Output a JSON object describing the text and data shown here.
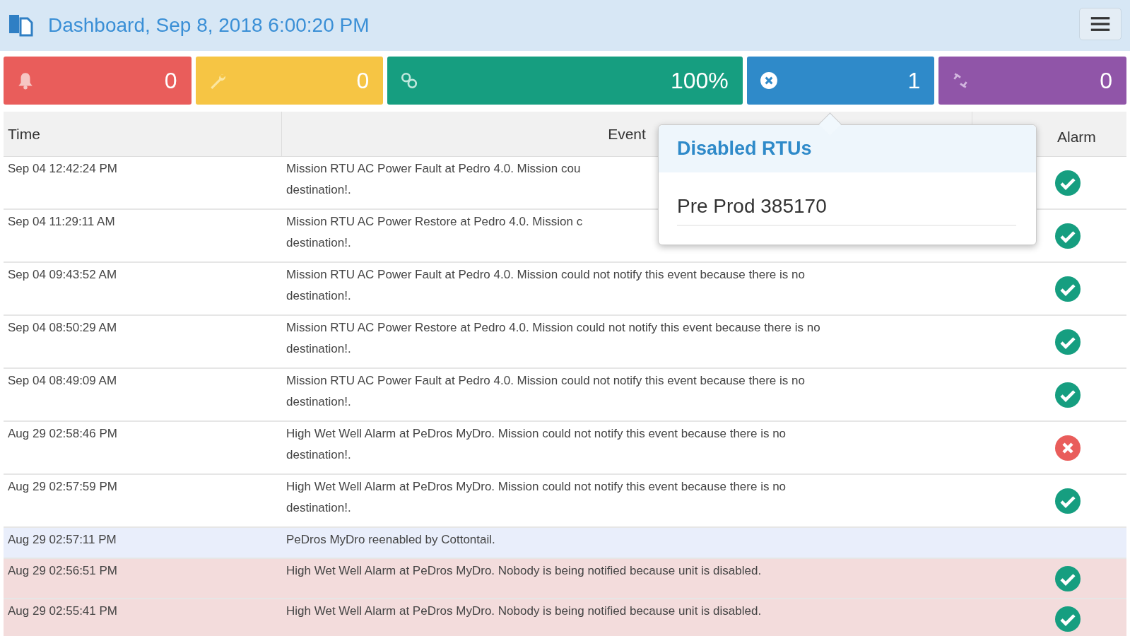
{
  "header": {
    "title": "Dashboard, Sep 8, 2018 6:00:20 PM"
  },
  "tiles": [
    {
      "kind": "alarms",
      "value": "0",
      "color": "#e95d5b"
    },
    {
      "kind": "maintenance",
      "value": "0",
      "color": "#f6c544"
    },
    {
      "kind": "connected",
      "value": "100%",
      "color": "#169e80"
    },
    {
      "kind": "disabled",
      "value": "1",
      "color": "#2f8ac9"
    },
    {
      "kind": "disconnected",
      "value": "0",
      "color": "#9055a8"
    }
  ],
  "table": {
    "columns": [
      "Time",
      "Event",
      "Alarm"
    ],
    "rows": [
      {
        "kind": "normal",
        "time": "Sep 04 12:42:24 PM",
        "event": [
          "Mission RTU AC Power Fault at Pedro 4.0. Mission cou",
          "destination!."
        ],
        "alarm": {
          "kind": "check"
        }
      },
      {
        "kind": "normal",
        "time": "Sep 04 11:29:11 AM",
        "event": [
          "Mission RTU AC Power Restore at Pedro 4.0. Mission c",
          "destination!."
        ],
        "alarm": {
          "kind": "check"
        }
      },
      {
        "kind": "normal",
        "time": "Sep 04 09:43:52 AM",
        "event": [
          "Mission RTU AC Power Fault at Pedro 4.0. Mission could not notify this event because there is no",
          "destination!."
        ],
        "alarm": {
          "kind": "check"
        }
      },
      {
        "kind": "normal",
        "time": "Sep 04 08:50:29 AM",
        "event": [
          "Mission RTU AC Power Restore at Pedro 4.0. Mission could not notify this event because there is no",
          "destination!."
        ],
        "alarm": {
          "kind": "check"
        }
      },
      {
        "kind": "normal",
        "time": "Sep 04 08:49:09 AM",
        "event": [
          "Mission RTU AC Power Fault at Pedro 4.0. Mission could not notify this event because there is no",
          "destination!."
        ],
        "alarm": {
          "kind": "check"
        }
      },
      {
        "kind": "normal",
        "time": "Aug 29 02:58:46 PM",
        "event": [
          "High Wet Well Alarm at PeDros MyDro. Mission could not notify this event because there is no",
          "destination!."
        ],
        "alarm": {
          "kind": "cross"
        }
      },
      {
        "kind": "normal",
        "time": "Aug 29 02:57:59 PM",
        "event": [
          "High Wet Well Alarm at PeDros MyDro. Mission could not notify this event because there is no",
          "destination!."
        ],
        "alarm": {
          "kind": "check"
        }
      },
      {
        "kind": "info",
        "time": "Aug 29 02:57:11 PM",
        "event": [
          "PeDros MyDro reenabled by Cottontail."
        ]
      },
      {
        "kind": "disabled",
        "time": "Aug 29 02:56:51 PM",
        "event": [
          "High Wet Well Alarm at PeDros MyDro. Nobody is being notified because unit is disabled."
        ],
        "alarm": {
          "kind": "check"
        }
      },
      {
        "kind": "disabled",
        "time": "Aug 29 02:55:41 PM",
        "event": [
          "High Wet Well Alarm at PeDros MyDro. Nobody is being notified because unit is disabled."
        ],
        "alarm": {
          "kind": "check"
        }
      }
    ]
  },
  "popover": {
    "title": "Disabled RTUs",
    "items": [
      "Pre Prod 385170"
    ]
  }
}
